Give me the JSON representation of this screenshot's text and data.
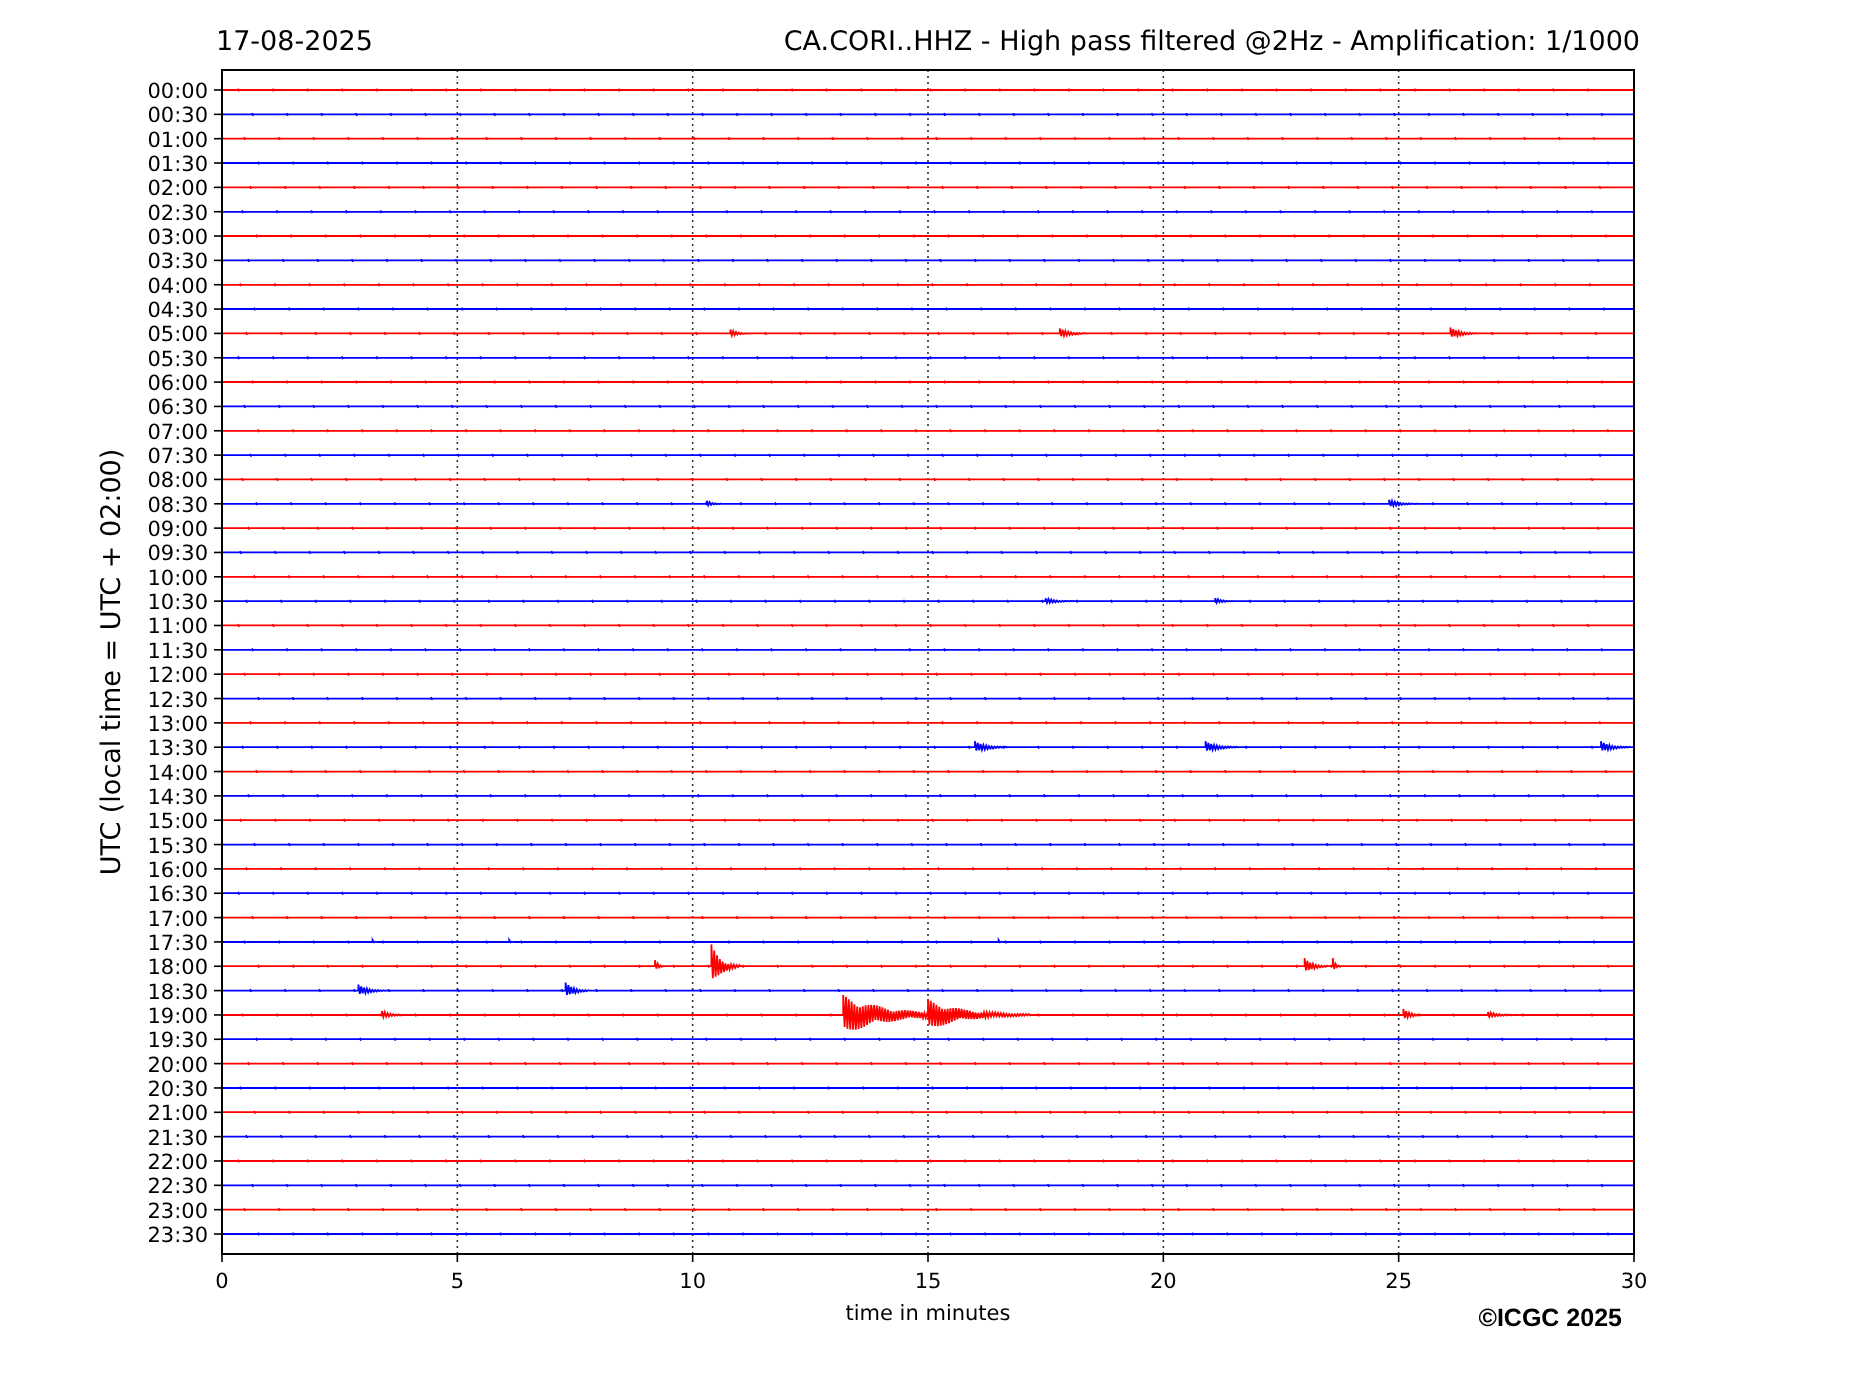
{
  "date": "17-08-2025",
  "title": "CA.CORI..HHZ - High pass filtered @2Hz - Amplification: 1/1000",
  "ylabel": "UTC (local time = UTC + 02:00)",
  "xlabel": "time in minutes",
  "xticks": [
    "0",
    "5",
    "10",
    "15",
    "20",
    "25",
    "30"
  ],
  "rows": [
    {
      "label": "00:00",
      "color": "#ff0000"
    },
    {
      "label": "00:30",
      "color": "#0000ff"
    },
    {
      "label": "01:00",
      "color": "#ff0000"
    },
    {
      "label": "01:30",
      "color": "#0000ff"
    },
    {
      "label": "02:00",
      "color": "#ff0000"
    },
    {
      "label": "02:30",
      "color": "#0000ff"
    },
    {
      "label": "03:00",
      "color": "#ff0000"
    },
    {
      "label": "03:30",
      "color": "#0000ff"
    },
    {
      "label": "04:00",
      "color": "#ff0000"
    },
    {
      "label": "04:30",
      "color": "#0000ff"
    },
    {
      "label": "05:00",
      "color": "#ff0000"
    },
    {
      "label": "05:30",
      "color": "#0000ff"
    },
    {
      "label": "06:00",
      "color": "#ff0000"
    },
    {
      "label": "06:30",
      "color": "#0000ff"
    },
    {
      "label": "07:00",
      "color": "#ff0000"
    },
    {
      "label": "07:30",
      "color": "#0000ff"
    },
    {
      "label": "08:00",
      "color": "#ff0000"
    },
    {
      "label": "08:30",
      "color": "#0000ff"
    },
    {
      "label": "09:00",
      "color": "#ff0000"
    },
    {
      "label": "09:30",
      "color": "#0000ff"
    },
    {
      "label": "10:00",
      "color": "#ff0000"
    },
    {
      "label": "10:30",
      "color": "#0000ff"
    },
    {
      "label": "11:00",
      "color": "#ff0000"
    },
    {
      "label": "11:30",
      "color": "#0000ff"
    },
    {
      "label": "12:00",
      "color": "#ff0000"
    },
    {
      "label": "12:30",
      "color": "#0000ff"
    },
    {
      "label": "13:00",
      "color": "#ff0000"
    },
    {
      "label": "13:30",
      "color": "#0000ff"
    },
    {
      "label": "14:00",
      "color": "#ff0000"
    },
    {
      "label": "14:30",
      "color": "#0000ff"
    },
    {
      "label": "15:00",
      "color": "#ff0000"
    },
    {
      "label": "15:30",
      "color": "#0000ff"
    },
    {
      "label": "16:00",
      "color": "#ff0000"
    },
    {
      "label": "16:30",
      "color": "#0000ff"
    },
    {
      "label": "17:00",
      "color": "#ff0000"
    },
    {
      "label": "17:30",
      "color": "#0000ff"
    },
    {
      "label": "18:00",
      "color": "#ff0000"
    },
    {
      "label": "18:30",
      "color": "#0000ff"
    },
    {
      "label": "19:00",
      "color": "#ff0000"
    },
    {
      "label": "19:30",
      "color": "#0000ff"
    },
    {
      "label": "20:00",
      "color": "#ff0000"
    },
    {
      "label": "20:30",
      "color": "#0000ff"
    },
    {
      "label": "21:00",
      "color": "#ff0000"
    },
    {
      "label": "21:30",
      "color": "#0000ff"
    },
    {
      "label": "22:00",
      "color": "#ff0000"
    },
    {
      "label": "22:30",
      "color": "#0000ff"
    },
    {
      "label": "23:00",
      "color": "#ff0000"
    },
    {
      "label": "23:30",
      "color": "#0000ff"
    }
  ],
  "copyright": "©ICGC 2025"
}
